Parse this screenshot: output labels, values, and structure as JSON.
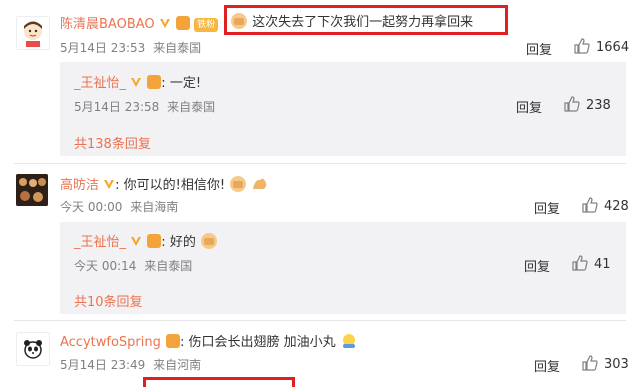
{
  "comments": [
    {
      "user": "陈清晨BAOBAO",
      "text": "这次失去了下次我们一起努力再拿回来",
      "time": "5月14日 23:53",
      "location": "来自泰国",
      "reply_label": "回复",
      "likes": "1664",
      "badge_label": "铁粉",
      "nested": {
        "user": "_王祉怡_",
        "text": "一定!",
        "time": "5月14日 23:58",
        "location": "来自泰国",
        "reply_label": "回复",
        "likes": "238",
        "more": "共138条回复"
      }
    },
    {
      "user": "高昉洁",
      "text": "你可以的!相信你!",
      "time": "今天 00:00",
      "location": "来自海南",
      "reply_label": "回复",
      "likes": "428",
      "nested": {
        "user": "_王祉怡_",
        "text": "好的",
        "time": "今天 00:14",
        "location": "来自泰国",
        "reply_label": "回复",
        "likes": "41",
        "more": "共10条回复"
      }
    },
    {
      "user": "AccytwfoSpring",
      "text": "伤口会长出翅膀 加油小丸",
      "time": "5月14日 23:49",
      "location": "来自河南",
      "reply_label": "回复",
      "likes": "303"
    }
  ],
  "colors": {
    "name": "#eb7350",
    "highlight": "#e02020",
    "reply_bg": "#f2f2f5"
  }
}
